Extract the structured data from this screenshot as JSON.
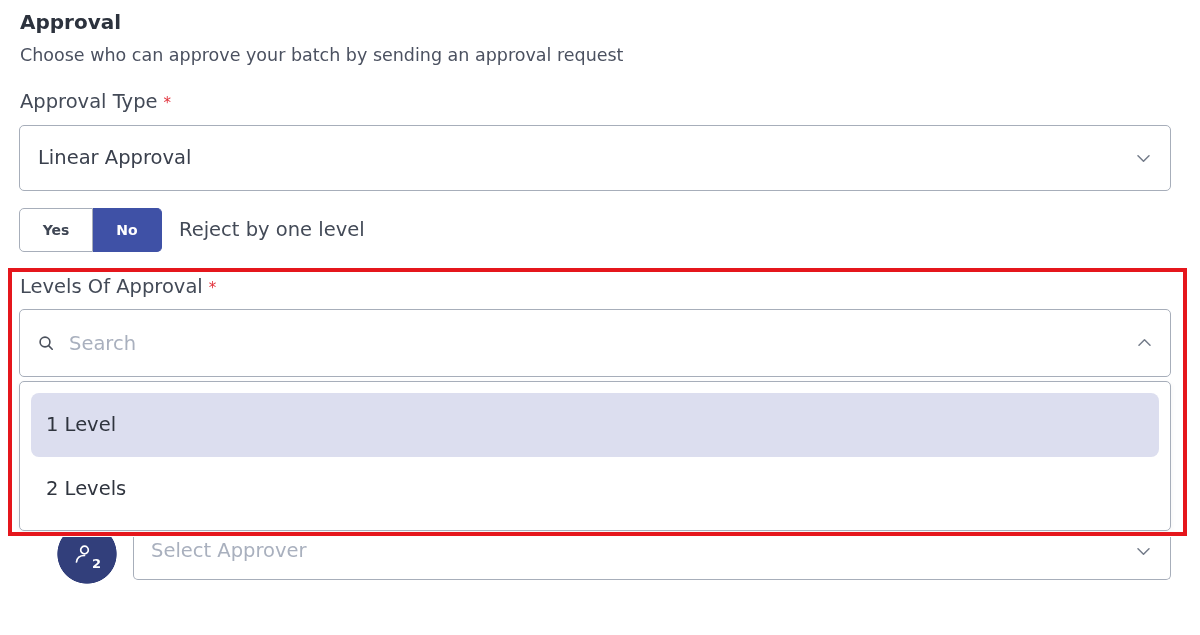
{
  "section": {
    "title": "Approval",
    "description": "Choose who can approve your batch by sending an approval request"
  },
  "approval_type": {
    "label": "Approval Type",
    "required_mark": "*",
    "value": "Linear Approval",
    "expanded": false
  },
  "reject_by_one_level": {
    "options": [
      {
        "label": "Yes",
        "selected": false
      },
      {
        "label": "No",
        "selected": true
      }
    ],
    "label": "Reject by one level"
  },
  "levels_of_approval": {
    "label": "Levels Of Approval",
    "required_mark": "*",
    "highlighted": true,
    "search": {
      "placeholder": "Search",
      "expanded": true
    },
    "options": [
      {
        "label": "1 Level",
        "selected": true
      },
      {
        "label": "2 Levels",
        "selected": false
      }
    ]
  },
  "approver": {
    "index_label": "2",
    "placeholder": "Select Approver",
    "expanded": false
  }
}
